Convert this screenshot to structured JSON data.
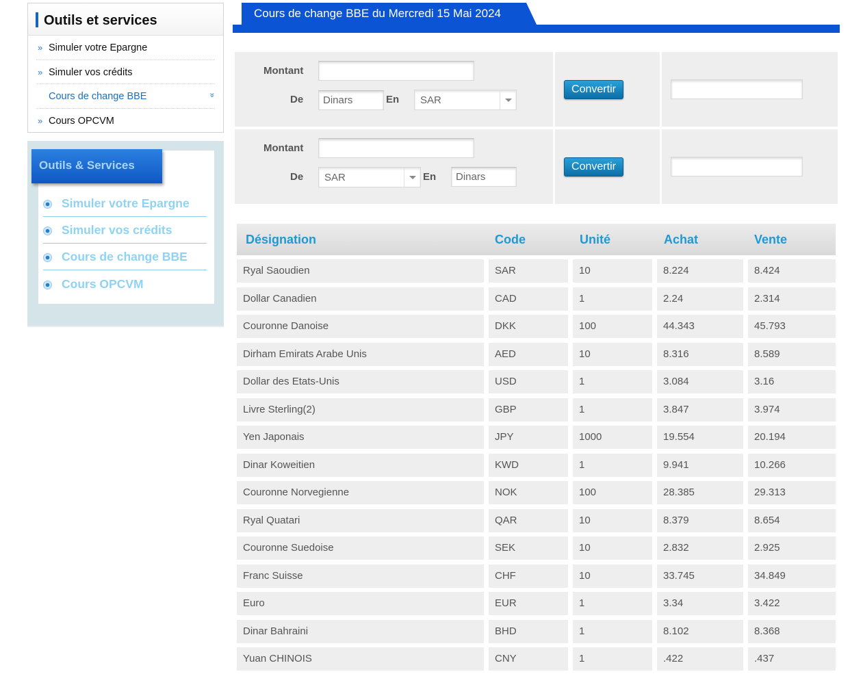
{
  "sidebar_top": {
    "title": "Outils et services",
    "items": [
      {
        "label": "Simuler votre Epargne",
        "marker": "»"
      },
      {
        "label": "Simuler vos crédits",
        "marker": "»"
      },
      {
        "label": "Cours de change BBE",
        "marker": "",
        "active": true,
        "chevron": "»"
      },
      {
        "label": "Cours OPCVM",
        "marker": "»"
      }
    ]
  },
  "sidebar_services": {
    "title": "Outils & Services",
    "items": [
      {
        "label": "Simuler votre Epargne"
      },
      {
        "label": "Simuler vos crédits"
      },
      {
        "label": "Cours de change BBE"
      },
      {
        "label": "Cours OPCVM"
      }
    ]
  },
  "tab": {
    "title": "Cours de change BBE du Mercredi 15 Mai 2024"
  },
  "converter1": {
    "amount_label": "Montant",
    "amount_value": "",
    "from_label": "De",
    "from_value": "Dinars",
    "to_label": "En",
    "to_value": "SAR",
    "button": "Convertir",
    "result": ""
  },
  "converter2": {
    "amount_label": "Montant",
    "amount_value": "",
    "from_label": "De",
    "from_value": "SAR",
    "to_label": "En",
    "to_value": "Dinars",
    "button": "Convertir",
    "result": ""
  },
  "table": {
    "headers": [
      "Désignation",
      "Code",
      "Unité",
      "Achat",
      "Vente"
    ],
    "rows": [
      [
        "Ryal Saoudien",
        "SAR",
        "10",
        "8.224",
        "8.424"
      ],
      [
        "Dollar Canadien",
        "CAD",
        "1",
        "2.24",
        "2.314"
      ],
      [
        "Couronne Danoise",
        "DKK",
        "100",
        "44.343",
        "45.793"
      ],
      [
        "Dirham Emirats Arabe Unis",
        "AED",
        "10",
        "8.316",
        "8.589"
      ],
      [
        "Dollar des Etats-Unis",
        "USD",
        "1",
        "3.084",
        "3.16"
      ],
      [
        "Livre Sterling(2)",
        "GBP",
        "1",
        "3.847",
        "3.974"
      ],
      [
        "Yen Japonais",
        "JPY",
        "1000",
        "19.554",
        "20.194"
      ],
      [
        "Dinar Koweitien",
        "KWD",
        "1",
        "9.941",
        "10.266"
      ],
      [
        "Couronne Norvegienne",
        "NOK",
        "100",
        "28.385",
        "29.313"
      ],
      [
        "Ryal Quatari",
        "QAR",
        "10",
        "8.379",
        "8.654"
      ],
      [
        "Couronne Suedoise",
        "SEK",
        "10",
        "2.832",
        "2.925"
      ],
      [
        "Franc Suisse",
        "CHF",
        "10",
        "33.745",
        "34.849"
      ],
      [
        "Euro",
        "EUR",
        "1",
        "3.34",
        "3.422"
      ],
      [
        "Dinar Bahraini",
        "BHD",
        "1",
        "8.102",
        "8.368"
      ],
      [
        "Yuan CHINOIS",
        "CNY",
        "1",
        ".422",
        ".437"
      ]
    ]
  },
  "colors": {
    "brand_blue": "#0b54d4",
    "header_text": "#1d9ad6",
    "button": "#1486c2",
    "service_text": "#8fd3f2"
  }
}
